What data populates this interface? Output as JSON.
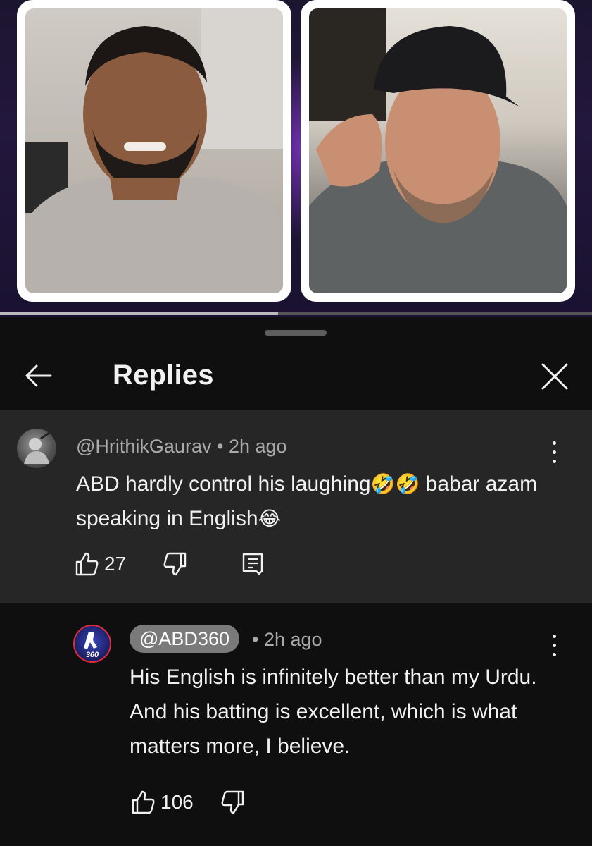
{
  "video": {
    "progress_fraction": 0.47
  },
  "sheet": {
    "title": "Replies"
  },
  "parent_comment": {
    "author": "@HrithikGaurav",
    "separator": "•",
    "time": "2h ago",
    "text_part1": "ABD hardly control his laughing",
    "emoji1": "🤣🤣",
    "text_part2": " babar azam speaking in English",
    "emoji2": "😂",
    "likes": "27"
  },
  "reply": {
    "author": "@ABD360",
    "avatar_text": "360",
    "separator": "•",
    "time": "2h ago",
    "text": "His English is infinitely better than my Urdu. And his batting is excellent, which is what matters more, I believe.",
    "likes": "106"
  },
  "icons": {
    "back": "arrow-left-icon",
    "close": "close-icon",
    "more": "more-vertical-icon",
    "like": "thumb-up-icon",
    "dislike": "thumb-down-icon",
    "reply": "comment-reply-icon"
  },
  "colors": {
    "background": "#0f0f0f",
    "parent_highlight": "#262626",
    "secondary_text": "#aaaaaa",
    "mention_chip": "#7a7a7a",
    "video_purple": "#23173d"
  }
}
